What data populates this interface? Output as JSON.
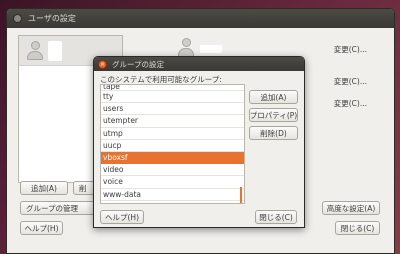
{
  "main_window": {
    "title": "ユーザの設定",
    "change_links": [
      "変更(C)...",
      "変更(C)...",
      "変更(C)..."
    ],
    "buttons": {
      "add": "追加(A)",
      "delete": "削",
      "manage_groups": "グループの管理",
      "help": "ヘルプ(H)",
      "advanced": "高度な設定(A)",
      "close": "閉じる(C)"
    }
  },
  "group_dialog": {
    "title": "グループの設定",
    "prompt": "このシステムで利用可能なグループ:",
    "groups": [
      "tape",
      "tty",
      "users",
      "utempter",
      "utmp",
      "uucp",
      "vboxsf",
      "video",
      "voice",
      "www-data"
    ],
    "selected_group": "vboxsf",
    "buttons": {
      "add": "追加(A)",
      "properties": "プロパティ(P)",
      "delete": "削除(D)",
      "help": "ヘルプ(H)",
      "close": "閉じる(C)"
    }
  },
  "colors": {
    "accent": "#e8722f",
    "title_bar": "#3c3b37",
    "window_bg": "#f0efec"
  }
}
